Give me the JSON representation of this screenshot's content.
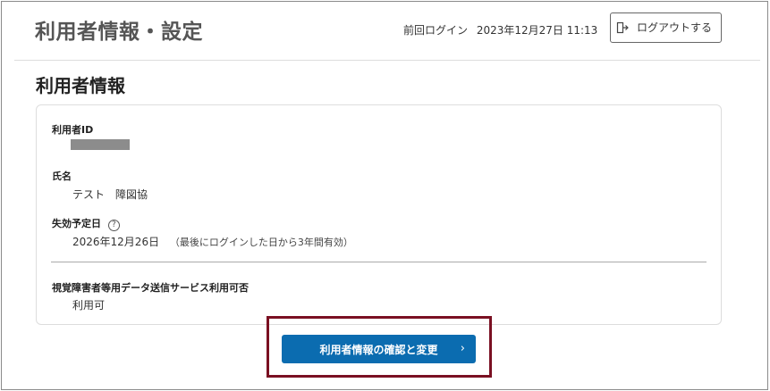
{
  "header": {
    "title": "利用者情報・設定",
    "last_login_label": "前回ログイン",
    "last_login_datetime": "2023年12月27日 11:13",
    "logout_label": "ログアウトする"
  },
  "section": {
    "title": "利用者情報"
  },
  "fields": {
    "user_id": {
      "label": "利用者ID",
      "value": ""
    },
    "name": {
      "label": "氏名",
      "value": "テスト　障図協"
    },
    "expiry": {
      "label": "失効予定日",
      "help": "?",
      "value": "2026年12月26日",
      "note": "（最後にログインした日から3年間有効）"
    },
    "service": {
      "label": "視覚障害者等用データ送信サービス利用可否",
      "value": "利用可"
    }
  },
  "actions": {
    "confirm_change_label": "利用者情報の確認と変更",
    "chevron": "›"
  },
  "icons": {
    "logout": "logout-door-arrow-icon",
    "help": "question-circle-icon",
    "chevron": "chevron-right-icon"
  },
  "colors": {
    "primary_button": "#0b6cb0",
    "highlight_border": "#7a1022"
  }
}
